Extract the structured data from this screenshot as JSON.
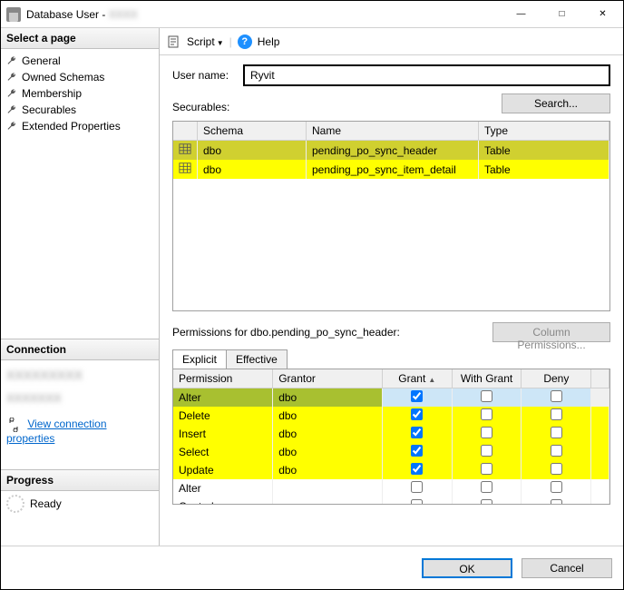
{
  "window": {
    "title_prefix": "Database User - ",
    "title_user_obscured": "XXXX"
  },
  "sidebar": {
    "select_page_header": "Select a page",
    "pages": [
      {
        "label": "General"
      },
      {
        "label": "Owned Schemas"
      },
      {
        "label": "Membership"
      },
      {
        "label": "Securables"
      },
      {
        "label": "Extended Properties"
      }
    ],
    "connection_header": "Connection",
    "connection_server_obscured": "XXXXXXXXX",
    "connection_user_obscured": "XXXXXXX",
    "view_conn_props": "View connection properties",
    "progress_header": "Progress",
    "progress_status": "Ready"
  },
  "toolbar": {
    "script_label": "Script",
    "help_label": "Help"
  },
  "form": {
    "username_label": "User name:",
    "username_value": "Ryvit",
    "securables_label": "Securables:",
    "search_button": "Search...",
    "securables_columns": {
      "schema": "Schema",
      "name": "Name",
      "type": "Type"
    },
    "securables_rows": [
      {
        "schema": "dbo",
        "name": "pending_po_sync_header",
        "type": "Table",
        "selected": true,
        "highlight": true
      },
      {
        "schema": "dbo",
        "name": "pending_po_sync_item_detail",
        "type": "Table",
        "selected": false,
        "highlight": true
      }
    ],
    "permissions_for_label": "Permissions for dbo.pending_po_sync_header:",
    "column_permissions_button": "Column Permissions...",
    "tabs": {
      "explicit": "Explicit",
      "effective": "Effective"
    },
    "perm_columns": {
      "permission": "Permission",
      "grantor": "Grantor",
      "grant": "Grant",
      "with_grant": "With Grant",
      "deny": "Deny"
    },
    "perm_rows": [
      {
        "permission": "Alter",
        "grantor": "dbo",
        "grant": true,
        "with_grant": false,
        "deny": false,
        "hl": true,
        "sel": true
      },
      {
        "permission": "Delete",
        "grantor": "dbo",
        "grant": true,
        "with_grant": false,
        "deny": false,
        "hl": true
      },
      {
        "permission": "Insert",
        "grantor": "dbo",
        "grant": true,
        "with_grant": false,
        "deny": false,
        "hl": true
      },
      {
        "permission": "Select",
        "grantor": "dbo",
        "grant": true,
        "with_grant": false,
        "deny": false,
        "hl": true
      },
      {
        "permission": "Update",
        "grantor": "dbo",
        "grant": true,
        "with_grant": false,
        "deny": false,
        "hl": true
      },
      {
        "permission": "Alter",
        "grantor": "",
        "grant": false,
        "with_grant": false,
        "deny": false
      },
      {
        "permission": "Control",
        "grantor": "",
        "grant": false,
        "with_grant": false,
        "deny": false
      }
    ]
  },
  "footer": {
    "ok": "OK",
    "cancel": "Cancel"
  }
}
